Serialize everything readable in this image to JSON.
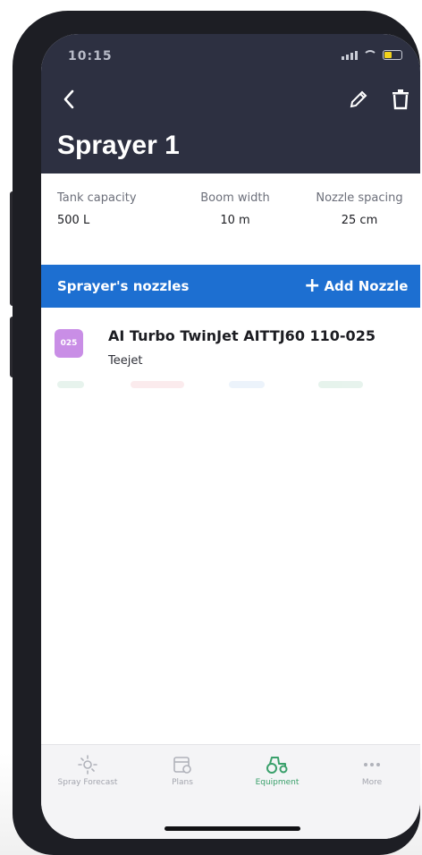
{
  "status": {
    "time": "10:15"
  },
  "header": {
    "title": "Sprayer 1"
  },
  "specs": [
    {
      "label": "Tank capacity",
      "value": "500 L"
    },
    {
      "label": "Boom width",
      "value": "10 m"
    },
    {
      "label": "Nozzle spacing",
      "value": "25 cm"
    }
  ],
  "nozzles_section": {
    "title": "Sprayer's nozzles",
    "add_label": "Add Nozzle",
    "add_icon": "plus-icon"
  },
  "nozzles": [
    {
      "badge": "025",
      "name": "AI Turbo TwinJet AITTJ60 110-025",
      "brand": "Teejet",
      "badge_color": "#c98ee6"
    }
  ],
  "tabs": [
    {
      "label": "Spray Forecast",
      "icon": "sun-icon",
      "active": false
    },
    {
      "label": "Plans",
      "icon": "calendar-icon",
      "active": false
    },
    {
      "label": "Equipment",
      "icon": "tractor-icon",
      "active": true
    },
    {
      "label": "More",
      "icon": "more-icon",
      "active": false
    }
  ],
  "colors": {
    "header_bg": "#2d3041",
    "accent_blue": "#1d6fd1",
    "active_tab": "#3aa06b"
  }
}
